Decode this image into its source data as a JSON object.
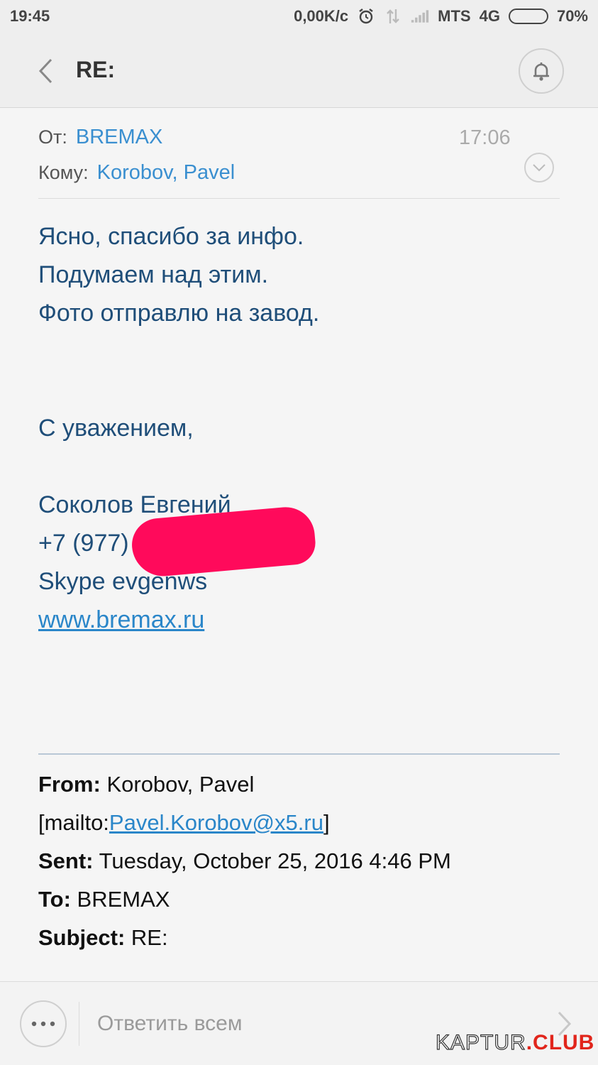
{
  "status_bar": {
    "time": "19:45",
    "network_speed": "0,00K/c",
    "carrier": "MTS",
    "network_type": "4G",
    "battery": "70%",
    "battery_level": 0.7
  },
  "header": {
    "title": "RE:"
  },
  "mail": {
    "from_label": "От:",
    "from_value": "BREMAX",
    "to_label": "Кому:",
    "to_value": "Korobov, Pavel",
    "time": "17:06"
  },
  "body": {
    "lines": [
      "Ясно, спасибо за инфо.",
      "Подумаем над этим.",
      "Фото отправлю на завод."
    ],
    "greeting": "С уважением,",
    "signature_name": "Соколов Евгений",
    "signature_phone": "+7 (977)",
    "signature_skype": "Skype evgenws",
    "signature_site": "www.bremax.ru"
  },
  "quote": {
    "from_label": "From:",
    "from_value": "Korobov, Pavel",
    "mailto_prefix": "[mailto:",
    "mailto_email": "Pavel.Korobov@x5.ru",
    "mailto_suffix": "]",
    "sent_label": "Sent:",
    "sent_value": "Tuesday, October 25, 2016 4:46 PM",
    "to_label": "To:",
    "to_value": "BREMAX",
    "subject_label": "Subject:",
    "subject_value": "RE:"
  },
  "footer": {
    "reply_all": "Ответить всем"
  },
  "watermark": {
    "main": "KAPTUR",
    "accent": ".CLUB"
  },
  "colors": {
    "link": "#2a86c9",
    "body_text": "#1f4e79",
    "redaction": "#ff0a5b"
  }
}
